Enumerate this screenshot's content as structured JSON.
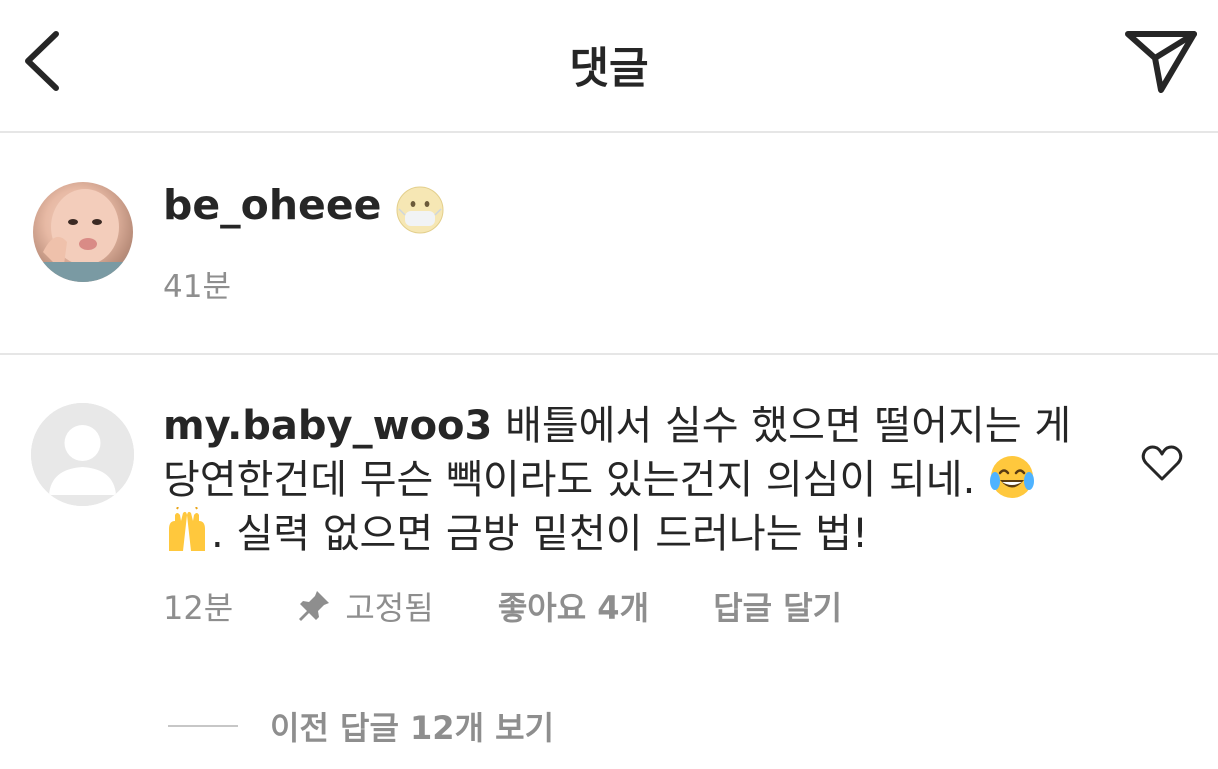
{
  "header": {
    "title": "댓글",
    "back_icon": "chevron-left-icon",
    "send_icon": "paper-plane-icon"
  },
  "caption": {
    "username": "be_oheee",
    "emoji": "face-with-medical-mask-emoji",
    "time": "41분"
  },
  "comment": {
    "username": "my.baby_woo3",
    "text_part1": " 배틀에서 실수 했으면 떨어지는 게 당연한건데 무슨 빽이라도 있는건지 의심이 되네. ",
    "emoji1": "face-with-tears-of-joy-emoji",
    "emoji2": "raising-hands-emoji",
    "text_part2": ". 실력 없으면 금방 밑천이 드러나는 법!",
    "time": "12분",
    "pinned_label": "고정됨",
    "likes_label": "좋아요 4개",
    "reply_label": "답글 달기",
    "heart_icon": "heart-outline-icon",
    "pin_icon": "pin-icon"
  },
  "replies": {
    "view_label": "이전 답글 12개 보기"
  },
  "colors": {
    "text": "#262626",
    "secondary": "#8e8e8e",
    "divider": "#e6e6e6",
    "background": "#ffffff"
  }
}
